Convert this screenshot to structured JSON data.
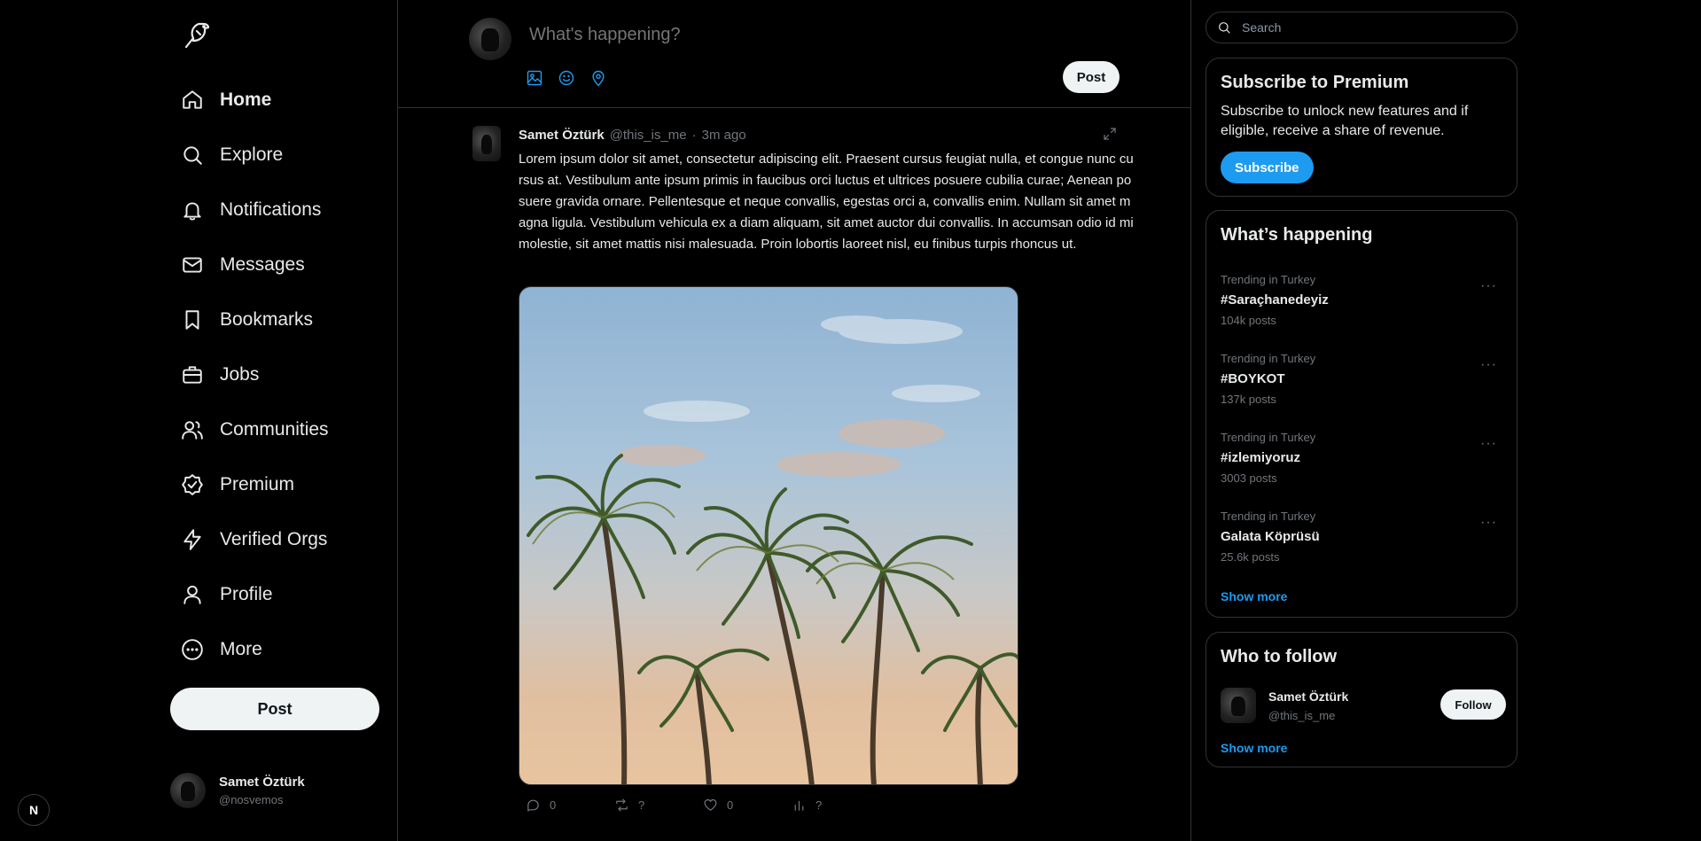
{
  "sidebar": {
    "logo_icon": "bird-logo-icon",
    "nav": [
      {
        "label": "Home",
        "icon": "home-icon",
        "active": true
      },
      {
        "label": "Explore",
        "icon": "search-icon"
      },
      {
        "label": "Notifications",
        "icon": "bell-icon"
      },
      {
        "label": "Messages",
        "icon": "mail-icon"
      },
      {
        "label": "Bookmarks",
        "icon": "bookmark-icon"
      },
      {
        "label": "Jobs",
        "icon": "briefcase-icon"
      },
      {
        "label": "Communities",
        "icon": "users-icon"
      },
      {
        "label": "Premium",
        "icon": "badge-check-icon"
      },
      {
        "label": "Verified Orgs",
        "icon": "lightning-icon"
      },
      {
        "label": "Profile",
        "icon": "user-icon"
      },
      {
        "label": "More",
        "icon": "more-circle-icon"
      }
    ],
    "post_label": "Post",
    "user": {
      "name": "Samet Öztürk",
      "handle": "@nosvemos"
    },
    "badge": "N"
  },
  "composer": {
    "placeholder": "What's happening?",
    "post_label": "Post"
  },
  "tweet": {
    "author": "Samet Öztürk",
    "handle": "@this_is_me",
    "dot": "·",
    "time": "3m ago",
    "text": "Lorem ipsum dolor sit amet, consectetur adipiscing elit. Praesent cursus feugiat nulla, et congue nunc cursus at. Vestibulum ante ipsum primis in faucibus orci luctus et ultrices posuere cubilia curae; Aenean posuere gravida ornare. Pellentesque et neque convallis, egestas orci a, convallis enim. Nullam sit amet magna ligula. Vestibulum vehicula ex a diam aliquam, sit amet auctor dui convallis. In accumsan odio id mi molestie, sit amet mattis nisi malesuada. Proin lobortis laoreet nisl, eu finibus turpis rhoncus ut.",
    "actions": {
      "replies": "0",
      "reposts": "?",
      "likes": "0",
      "views": "?"
    }
  },
  "right": {
    "search_placeholder": "Search",
    "premium": {
      "title": "Subscribe to Premium",
      "desc": "Subscribe to unlock new features and if eligible, receive a share of revenue.",
      "button": "Subscribe"
    },
    "trends": {
      "title": "What’s happening",
      "items": [
        {
          "context": "Trending in Turkey",
          "tag": "#Saraçhanedeyiz",
          "count": "104k posts"
        },
        {
          "context": "Trending in Turkey",
          "tag": "#BOYKOT",
          "count": "137k posts"
        },
        {
          "context": "Trending in Turkey",
          "tag": "#izlemiyoruz",
          "count": "3003 posts"
        },
        {
          "context": "Trending in Turkey",
          "tag": "Galata Köprüsü",
          "count": "25.6k posts"
        }
      ],
      "more": "···",
      "show_more": "Show more"
    },
    "follow": {
      "title": "Who to follow",
      "user": {
        "name": "Samet Öztürk",
        "handle": "@this_is_me"
      },
      "button": "Follow",
      "show_more": "Show more"
    }
  },
  "colors": {
    "accent": "#1d9bf0",
    "background": "#000000",
    "border": "#2f3336",
    "muted": "#71767b"
  }
}
